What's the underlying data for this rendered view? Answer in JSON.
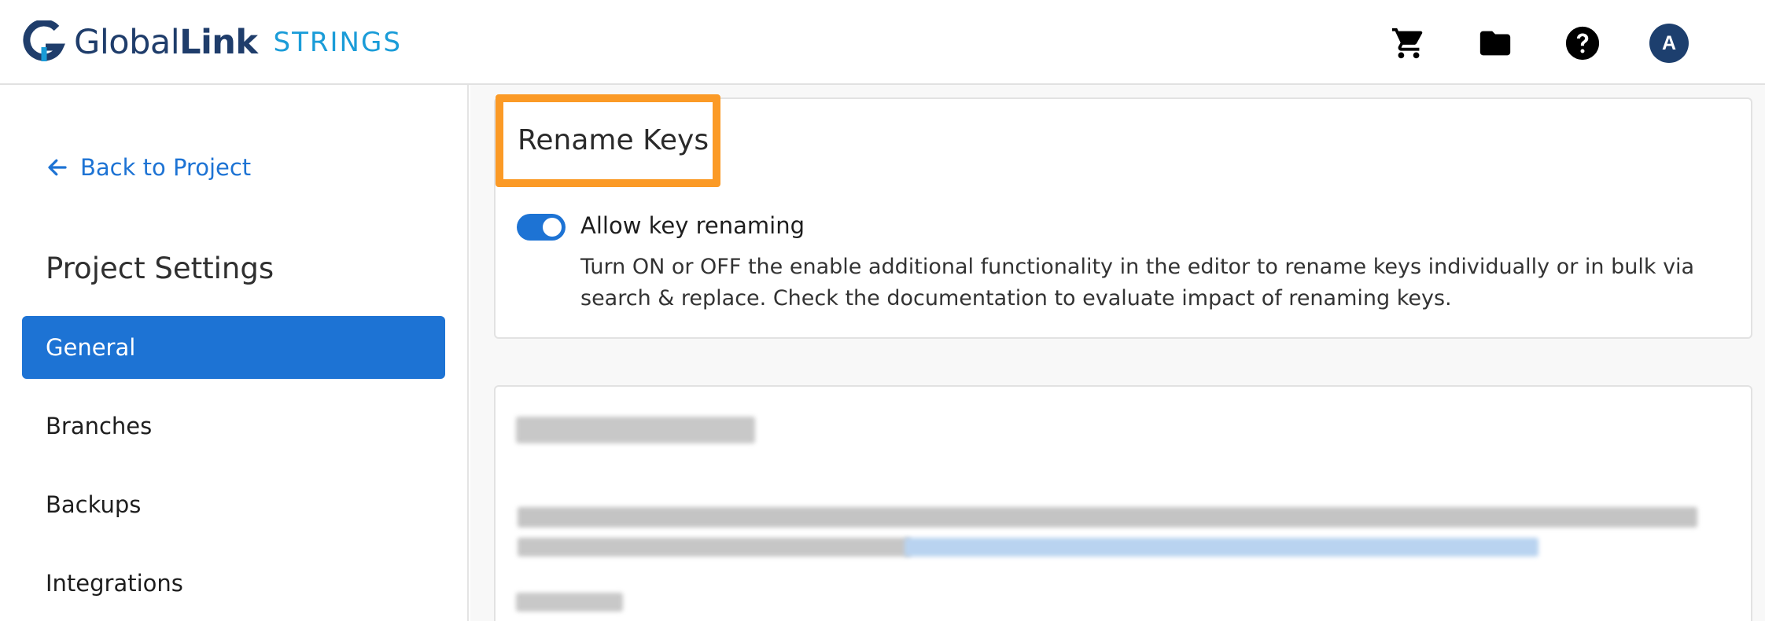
{
  "header": {
    "logo": {
      "word_global": "Global",
      "word_link": "Link",
      "product": "STRINGS"
    },
    "icons": [
      "cart-icon",
      "folder-icon",
      "help-icon"
    ],
    "avatar_initial": "A",
    "colors": {
      "logo_dark": "#1f3d6b",
      "logo_accent": "#1a9cd8",
      "avatar": "#1d3f6e"
    }
  },
  "sidebar": {
    "back_label": "Back to Project",
    "title": "Project Settings",
    "items": [
      {
        "label": "General",
        "active": true
      },
      {
        "label": "Branches",
        "active": false
      },
      {
        "label": "Backups",
        "active": false
      },
      {
        "label": "Integrations",
        "active": false
      }
    ]
  },
  "main": {
    "rename_card": {
      "title": "Rename Keys",
      "toggle_on": true,
      "toggle_label": "Allow key renaming",
      "description": "Turn ON or OFF the enable additional functionality in the editor to rename keys individually or in bulk via search & replace. Check the documentation to evaluate impact of renaming keys."
    }
  },
  "colors": {
    "primary": "#1d73d4",
    "highlight": "#fb9a26"
  }
}
